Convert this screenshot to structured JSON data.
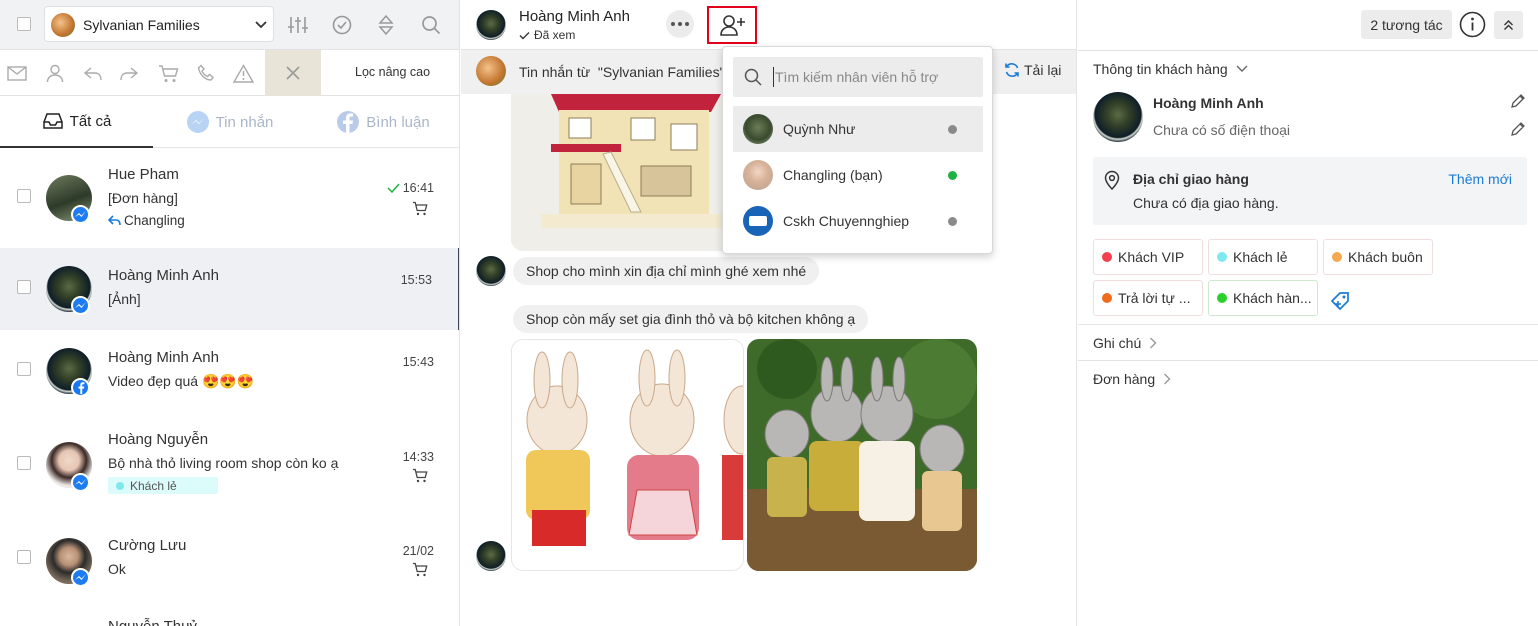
{
  "colors": {
    "accent": "#1a7bd6",
    "messenger": "#1e7cf2",
    "facebook": "#1877f2",
    "online": "#1fb142",
    "offline": "#8a8a8a",
    "highlight": "#e3001b"
  },
  "left": {
    "page_selector": "Sylvanian Families",
    "advanced_filter": "Lọc nâng cao",
    "tabs": {
      "all": "Tất cả",
      "messages": "Tin nhắn",
      "comments": "Bình luận"
    },
    "conversations": [
      {
        "name": "Hue Pham",
        "line1": "[Đơn hàng]",
        "line2": "Changling",
        "time": "16:41",
        "channel": "messenger"
      },
      {
        "name": "Hoàng Minh Anh",
        "line1": "[Ảnh]",
        "time": "15:53",
        "channel": "messenger"
      },
      {
        "name": "Hoàng Minh Anh",
        "line1": "Video đẹp quá 😍😍😍",
        "time": "15:43",
        "channel": "facebook"
      },
      {
        "name": "Hoàng Nguyễn",
        "line1": "Bộ nhà thỏ living room shop còn ko ạ",
        "tag": "Khách lẻ",
        "time": "14:33",
        "channel": "messenger"
      },
      {
        "name": "Cường Lưu",
        "line1": "Ok",
        "time": "21/02",
        "channel": "messenger"
      },
      {
        "name": "Nguyễn Thuỷ"
      }
    ]
  },
  "middle": {
    "contact_name": "Hoàng Minh Anh",
    "seen_status": "Đã xem",
    "interactions": "2 tương tác",
    "message_from": "Tin nhắn từ  \"Sylvanian Families\"",
    "reload": "Tải lại",
    "messages": [
      "Shop cho mình xin địa chỉ mình ghé xem nhé",
      "Shop còn mấy set gia đình thỏ và bộ kitchen không ạ"
    ]
  },
  "assign_dropdown": {
    "search_placeholder": "Tìm kiếm nhân viên hỗ trợ",
    "staff": [
      {
        "name": "Quỳnh Như",
        "status": "offline"
      },
      {
        "name": "Changling (bạn)",
        "status": "online"
      },
      {
        "name": "Cskh Chuyennghiep",
        "status": "offline"
      }
    ]
  },
  "right": {
    "section_title": "Thông tin khách hàng",
    "customer_name": "Hoàng Minh Anh",
    "phone": "Chưa có số điện thoại",
    "address_title": "Địa chỉ giao hàng",
    "add_new": "Thêm mới",
    "address_value": "Chưa có địa giao hàng.",
    "tags": [
      {
        "label": "Khách VIP",
        "color": "#f2404e"
      },
      {
        "label": "Khách lẻ",
        "color": "#7eeaf0"
      },
      {
        "label": "Khách buôn",
        "color": "#f5a94e"
      },
      {
        "label": "Trả lời tự ...",
        "color": "#f26a1b"
      },
      {
        "label": "Khách hàn...",
        "color": "#2bd12b"
      }
    ],
    "notes": "Ghi chú",
    "orders": "Đơn hàng"
  }
}
